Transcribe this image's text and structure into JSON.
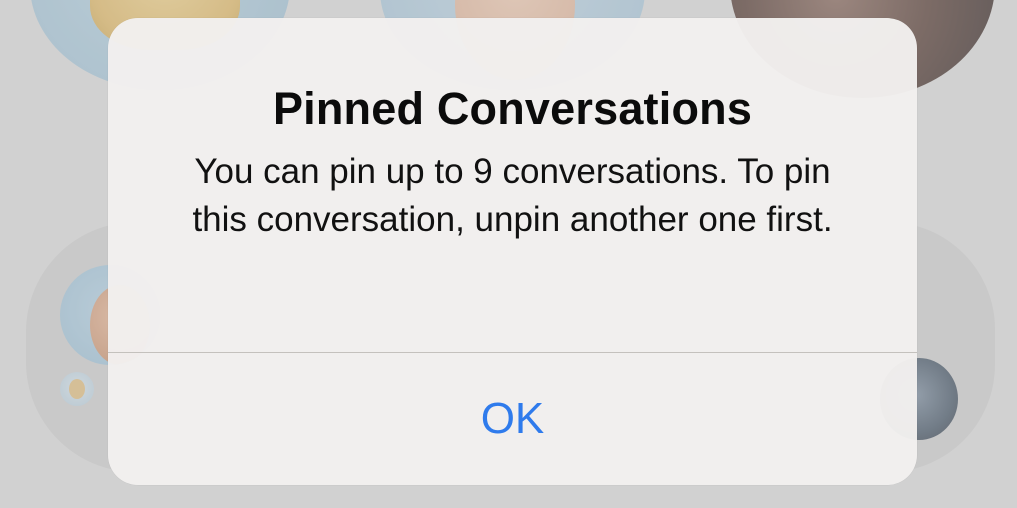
{
  "alert": {
    "title": "Pinned Conversations",
    "message": "You can pin up to 9 conversations. To pin this conversation, unpin another one first.",
    "ok_label": "OK"
  },
  "colors": {
    "accent": "#2f7bec",
    "alert_background": "#f2f0ee",
    "divider": "#c4c1bd",
    "backdrop": "#dcdcdc"
  },
  "background": {
    "pinned_avatars": [
      {
        "icon": "memoji-avatar"
      },
      {
        "icon": "memoji-avatar"
      },
      {
        "icon": "photo-avatar"
      },
      {
        "icon": "group-avatar"
      },
      {
        "icon": "group-avatar"
      }
    ]
  }
}
